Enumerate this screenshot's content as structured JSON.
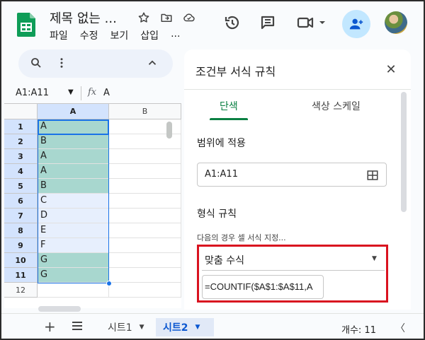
{
  "header": {
    "doc_title": "제목 없는 ...",
    "menu": [
      "파일",
      "수정",
      "보기",
      "삽입",
      "..."
    ]
  },
  "toolbar": {
    "icons": [
      "star-icon",
      "move-icon",
      "cloud-icon",
      "history-icon",
      "comment-icon",
      "meet-icon",
      "share-icon",
      "avatar"
    ]
  },
  "namebox": {
    "ref": "A1:A11",
    "fx": "fx",
    "formula_value": "A"
  },
  "grid": {
    "columns": [
      "A",
      "B"
    ],
    "rows": [
      {
        "num": "1",
        "a": "A",
        "highlight": true
      },
      {
        "num": "2",
        "a": "B",
        "highlight": true
      },
      {
        "num": "3",
        "a": "A",
        "highlight": true
      },
      {
        "num": "4",
        "a": "A",
        "highlight": true
      },
      {
        "num": "5",
        "a": "B",
        "highlight": true
      },
      {
        "num": "6",
        "a": "C",
        "highlight": false
      },
      {
        "num": "7",
        "a": "D",
        "highlight": false
      },
      {
        "num": "8",
        "a": "E",
        "highlight": false
      },
      {
        "num": "9",
        "a": "F",
        "highlight": false
      },
      {
        "num": "10",
        "a": "G",
        "highlight": true
      },
      {
        "num": "11",
        "a": "G",
        "highlight": true
      },
      {
        "num": "12",
        "a": "",
        "highlight": false
      }
    ]
  },
  "panel": {
    "title": "조건부 서식 규칙",
    "tab_single": "단색",
    "tab_scale": "색상 스케일",
    "range_label": "범위에 적용",
    "range_value": "A1:A11",
    "rules_label": "형식 규칙",
    "hint": "다음의 경우 셀 서식 지정...",
    "condition": "맞춤 수식",
    "formula": "=COUNTIF($A$1:$A$11,A"
  },
  "bottombar": {
    "sheet1": "시트1",
    "sheet2": "시트2",
    "count": "개수: 11"
  },
  "colors": {
    "highlight": "#a8d7cf",
    "selection": "#1a73e8",
    "accent_green": "#0b8043",
    "callout_red": "#d9121f"
  }
}
